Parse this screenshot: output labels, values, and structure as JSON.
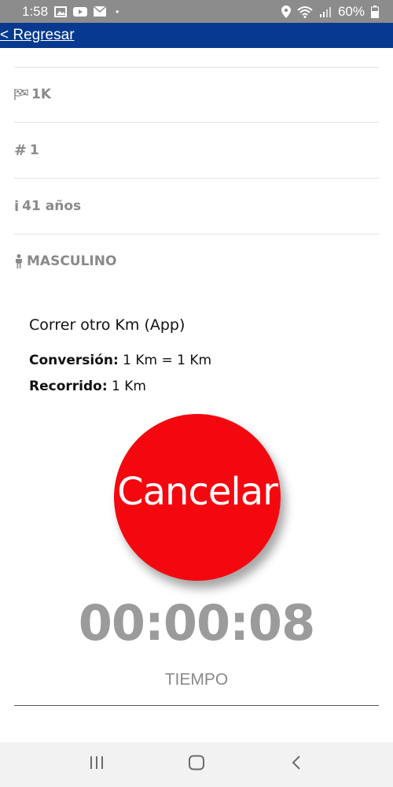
{
  "status_bar": {
    "time": "1:58",
    "dot": "•",
    "battery": "60%"
  },
  "header": {
    "back_label": "< Regresar"
  },
  "info": {
    "distance": "1K",
    "number": "1",
    "age": "41 años",
    "gender": "MASCULINO",
    "number_symbol": "#",
    "info_symbol": "i"
  },
  "details": {
    "activity_title": "Correr otro Km (App)",
    "conversion_label": "Conversión:",
    "conversion_value": " 1 Km = 1 Km",
    "route_label": "Recorrido:",
    "route_value": " 1 Km"
  },
  "action": {
    "cancel_label": "Cancelar"
  },
  "timer": {
    "value": "00:00:08",
    "label": "TIEMPO"
  },
  "colors": {
    "header": "#06398f",
    "cancel": "#f4080f",
    "status_bar": "#8c8c8c"
  }
}
